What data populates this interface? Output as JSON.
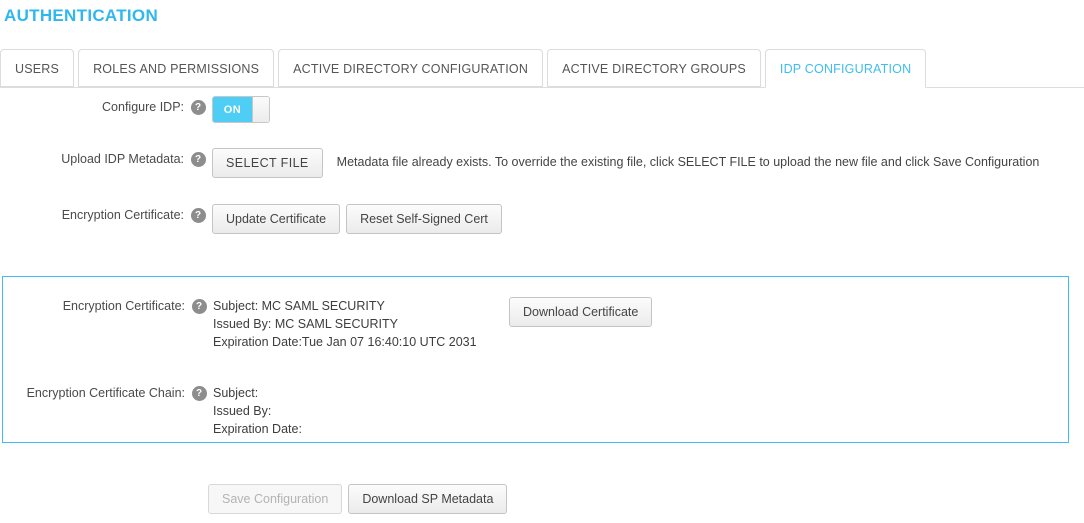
{
  "page": {
    "title": "AUTHENTICATION"
  },
  "tabs": [
    {
      "label": "USERS",
      "active": false
    },
    {
      "label": "ROLES AND PERMISSIONS",
      "active": false
    },
    {
      "label": "ACTIVE DIRECTORY CONFIGURATION",
      "active": false
    },
    {
      "label": "ACTIVE DIRECTORY GROUPS",
      "active": false
    },
    {
      "label": "IDP CONFIGURATION",
      "active": true
    }
  ],
  "form": {
    "configure_idp": {
      "label": "Configure IDP:",
      "help": "?",
      "toggle_state": "ON"
    },
    "upload_metadata": {
      "label": "Upload IDP Metadata:",
      "help": "?",
      "button": "SELECT FILE",
      "hint": "Metadata file already exists. To override the existing file, click SELECT FILE to upload the new file and click Save Configuration"
    },
    "encryption_certificate": {
      "label": "Encryption Certificate:",
      "help": "?",
      "update_button": "Update Certificate",
      "reset_button": "Reset Self-Signed Cert"
    }
  },
  "cert_panel": {
    "certificate": {
      "label": "Encryption Certificate:",
      "help": "?",
      "subject": "Subject: MC SAML SECURITY",
      "issued_by": "Issued By: MC SAML SECURITY",
      "expiration": "Expiration Date:Tue Jan 07 16:40:10 UTC 2031",
      "download_button": "Download Certificate"
    },
    "certificate_chain": {
      "label": "Encryption Certificate Chain:",
      "help": "?",
      "subject": "Subject:",
      "issued_by": "Issued By:",
      "expiration": "Expiration Date:"
    }
  },
  "footer": {
    "save_label": "Save Configuration",
    "download_sp_label": "Download SP Metadata"
  },
  "colors": {
    "accent": "#3fbdf0",
    "title": "#2fb8ef",
    "toggle_on": "#4ecdf5"
  }
}
